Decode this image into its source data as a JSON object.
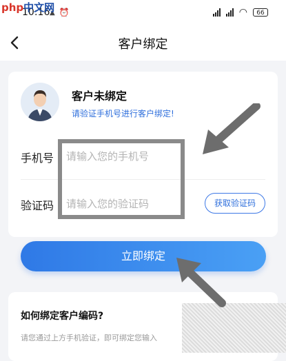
{
  "watermark": {
    "brand": "php",
    "suffix": "中文网"
  },
  "statusbar": {
    "time": "10:16",
    "battery": "66"
  },
  "nav": {
    "title": "客户绑定"
  },
  "customer": {
    "status": "客户未绑定",
    "hint": "请验证手机号进行客户绑定!"
  },
  "form": {
    "phone_label": "手机号",
    "phone_placeholder": "请输入您的手机号",
    "code_label": "验证码",
    "code_placeholder": "请输入您的验证码",
    "get_code_label": "获取验证码"
  },
  "actions": {
    "bind_label": "立即绑定"
  },
  "help": {
    "title": "如何绑定客户编码?",
    "text": "请您通过上方手机验证，即可绑定您输入"
  },
  "icons": [
    "back-icon",
    "avatar-icon",
    "signal-icon",
    "wifi-icon",
    "battery-icon",
    "alarm-icon"
  ],
  "colors": {
    "accent": "#2f79e6",
    "background": "#f3f4f7"
  }
}
